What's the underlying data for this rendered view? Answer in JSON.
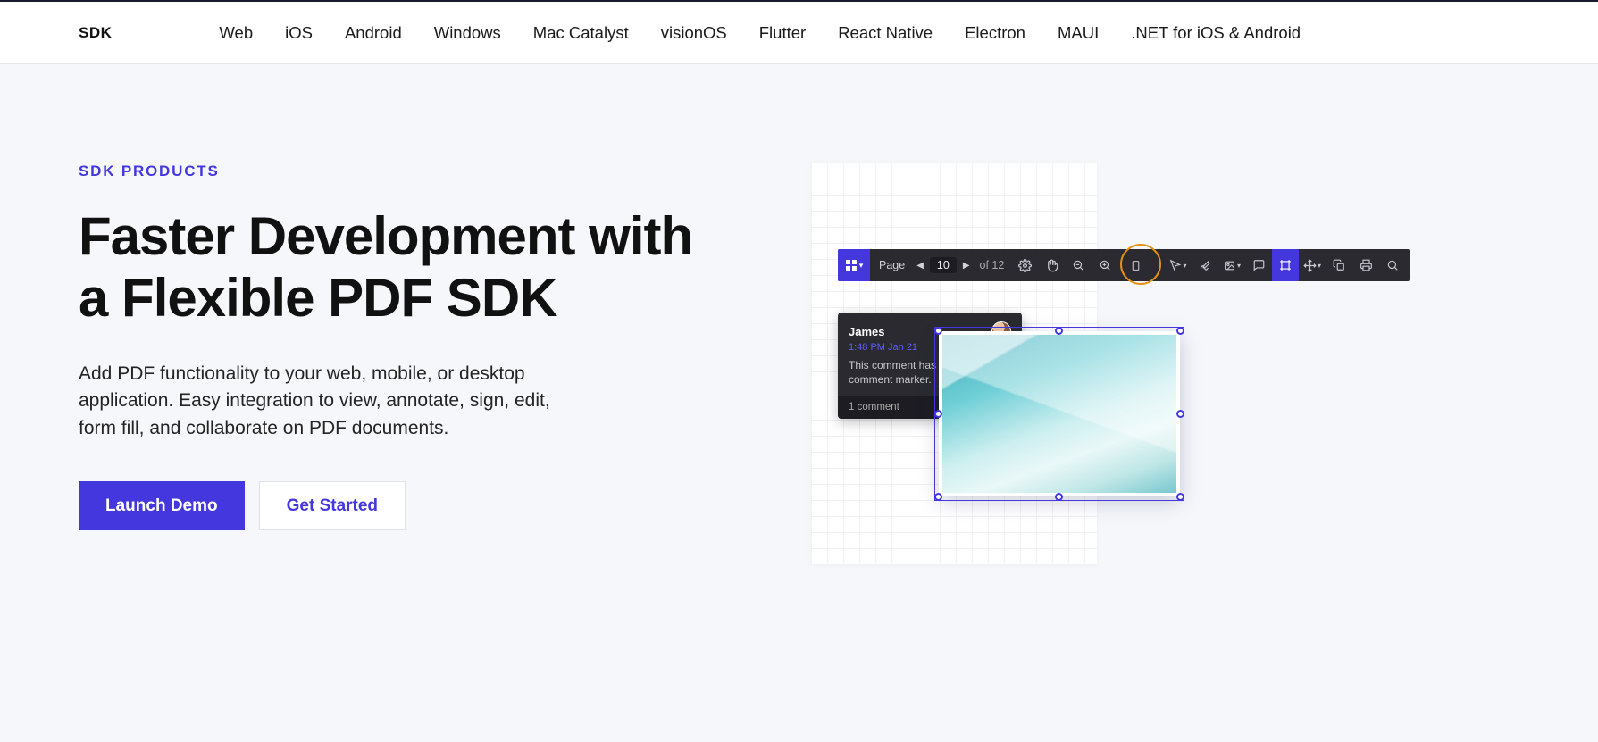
{
  "nav": {
    "brand": "SDK",
    "items": [
      "Web",
      "iOS",
      "Android",
      "Windows",
      "Mac Catalyst",
      "visionOS",
      "Flutter",
      "React Native",
      "Electron",
      "MAUI",
      ".NET for iOS & Android"
    ]
  },
  "hero": {
    "eyebrow": "SDK PRODUCTS",
    "headline": "Faster Development with a Flexible PDF SDK",
    "subcopy": "Add PDF functionality to your web, mobile, or desktop application. Easy integration to view, annotate, sign, edit, form fill, and collaborate on PDF documents.",
    "primary_cta": "Launch Demo",
    "secondary_cta": "Get Started"
  },
  "toolbar": {
    "page_label": "Page",
    "page_current": "10",
    "page_of": "of 12"
  },
  "comment": {
    "author": "James",
    "timestamp": "1:48 PM Jan 21",
    "body_line1": "This comment has been cre",
    "body_line2": "comment marker.",
    "footer": "1 comment"
  },
  "colors": {
    "accent": "#4537de",
    "toolbar_bg": "#2a2a30"
  }
}
